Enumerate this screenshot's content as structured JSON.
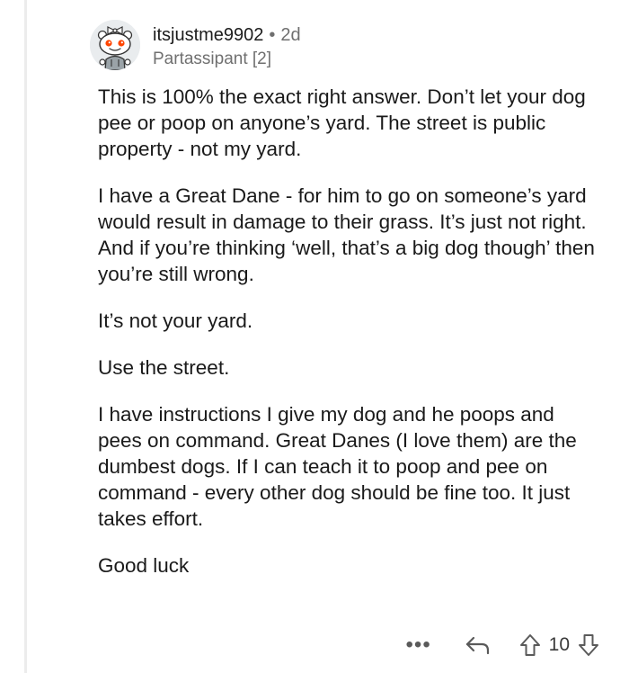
{
  "comment": {
    "username": "itsjustme9902",
    "separator": "•",
    "age": "2d",
    "flair": "Partassipant [2]",
    "paragraphs": [
      "This is 100% the exact right answer. Don’t let your dog pee or poop on anyone’s yard. The street is public property - not my yard.",
      "I have a Great Dane - for him to go on someone’s yard would result in damage to their grass. It’s just not right. And if you’re thinking ‘well, that’s a big dog though’ then you’re still wrong.",
      "It’s not your yard.",
      "Use the street.",
      "I have instructions I give my dog and he poops and pees on command. Great Danes (I love them) are the dumbest dogs. If I can teach it to poop and pee on command - every other dog should be fine too. It just takes effort.",
      "Good luck"
    ]
  },
  "actions": {
    "more_label": "•••",
    "vote_count": "10"
  },
  "icons": {
    "avatar": "reddit-snoo-avatar-icon",
    "more": "more-options-icon",
    "reply": "reply-arrow-icon",
    "upvote": "upvote-arrow-icon",
    "downvote": "downvote-arrow-icon"
  },
  "colors": {
    "text": "#1a1a1a",
    "meta": "#6f6f6f",
    "icon": "#5a5a5a",
    "thread_line": "#ececec",
    "avatar_bg": "#e9ecee",
    "avatar_accent": "#ff4500"
  }
}
